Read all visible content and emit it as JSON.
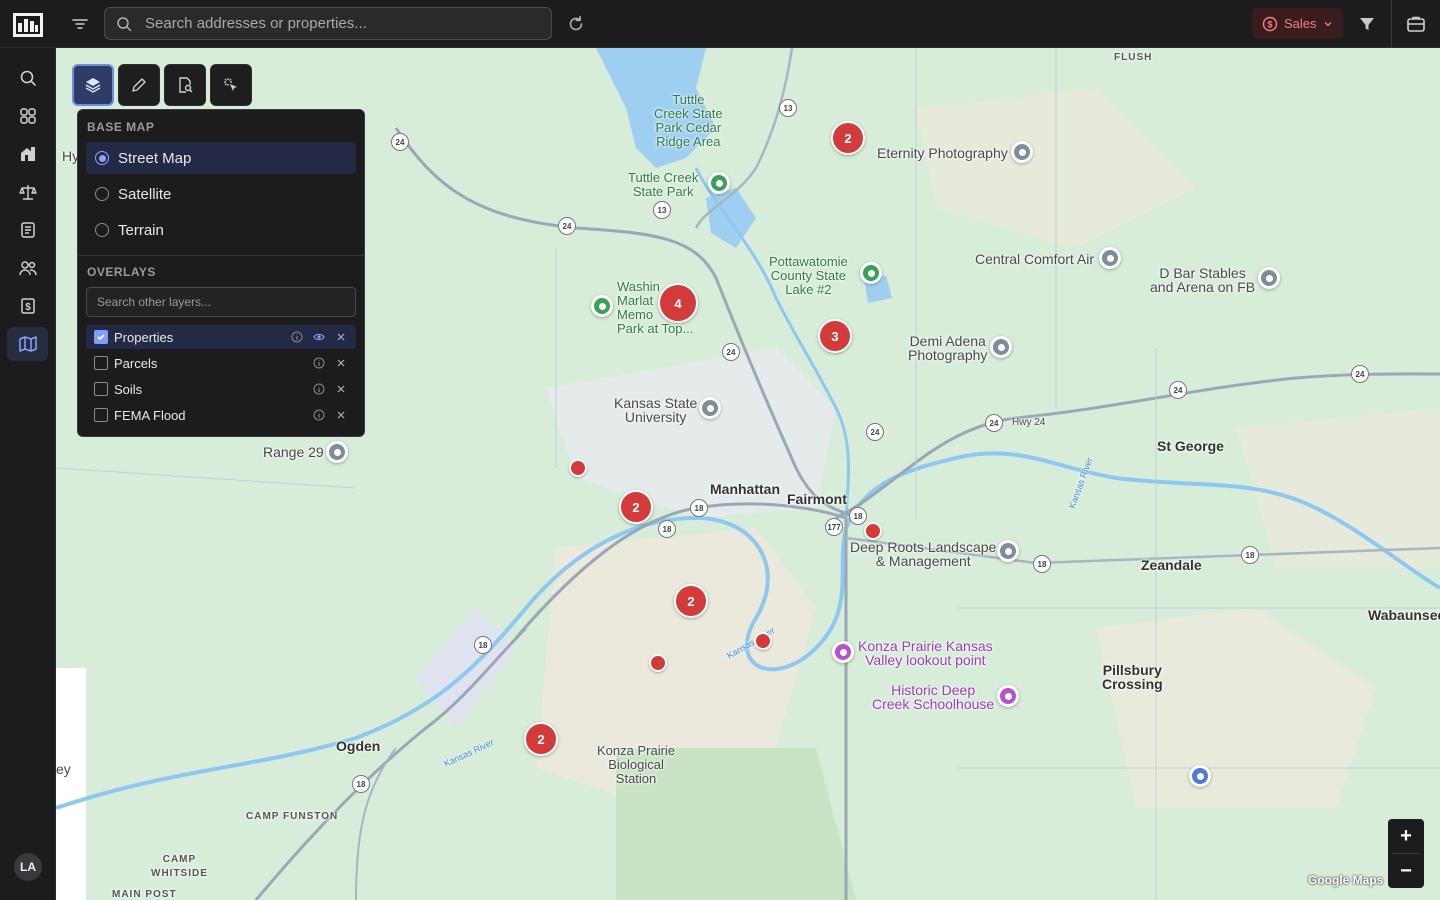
{
  "topbar": {
    "search_placeholder": "Search addresses or properties...",
    "sales_label": "Sales"
  },
  "sidebar": {
    "items": [
      "search",
      "dashboard",
      "properties",
      "legal",
      "documents",
      "contacts",
      "finance",
      "map"
    ],
    "active": "map",
    "avatar_initials": "LA"
  },
  "map_toolbar": {
    "tools": [
      "layers",
      "draw",
      "search-area",
      "select"
    ],
    "active": "layers"
  },
  "layers_panel": {
    "base_map_heading": "BASE MAP",
    "base_maps": [
      "Street Map",
      "Satellite",
      "Terrain"
    ],
    "selected_base_map": "Street Map",
    "overlays_heading": "OVERLAYS",
    "overlay_search_placeholder": "Search other layers...",
    "overlays": [
      {
        "name": "Properties",
        "checked": true
      },
      {
        "name": "Parcels",
        "checked": false
      },
      {
        "name": "Soils",
        "checked": false
      },
      {
        "name": "FEMA Flood",
        "checked": false
      }
    ]
  },
  "map": {
    "places": {
      "manhattan": "Manhattan",
      "fairmont": "Fairmont",
      "st_george": "St George",
      "zeandale": "Zeandale",
      "wabaunsee": "Wabaunsee",
      "ogden": "Ogden",
      "pillsbury": "Pillsbury\nCrossing",
      "flush": "FLUSH",
      "camp_funston": "CAMP FUNSTON",
      "camp_whitside": "CAMP\nWHITSIDE",
      "main_post": "MAIN POST",
      "range_29": "Range 29",
      "hwy24": "Hwy 24",
      "ey": "ey",
      "hy": "Hy"
    },
    "pois": {
      "tuttle_creek_park": "Tuttle\nCreek State\nPark Cedar\nRidge Area",
      "tuttle_creek_state_park": "Tuttle Creek\nState Park",
      "eternity": "Eternity Photography",
      "central_comfort": "Central Comfort Air",
      "d_bar": "D Bar Stables\nand Arena on FB",
      "pottawatomie": "Pottawatomie\nCounty State\nLake #2",
      "demi_adena": "Demi Adena\nPhotography",
      "washington_marlatt": "Washin\nMarlat\nMemo\nPark at Top...",
      "ksu": "Kansas State\nUniversity",
      "deep_roots": "Deep Roots Landscape\n& Management",
      "konza_lookout": "Konza Prairie Kansas\nValley lookout point",
      "historic_deep_creek": "Historic Deep\nCreek Schoolhouse",
      "konza_station": "Konza Prairie\nBiological\nStation"
    },
    "rivers": {
      "kansas_river_1": "Kansas River",
      "kansas_river_2": "Kansas River",
      "kansas_river_3": "Kansas River"
    },
    "route_shields": [
      "24",
      "13",
      "13",
      "24",
      "24",
      "24",
      "24",
      "24",
      "24",
      "18",
      "18",
      "177",
      "18",
      "18",
      "18",
      "18",
      "18"
    ],
    "clusters": [
      "2",
      "4",
      "3",
      "2",
      "2",
      "2"
    ],
    "attribution": "Google Maps"
  },
  "zoom": {
    "in": "+",
    "out": "−"
  },
  "colors": {
    "marker": "#d33b3b",
    "accent": "#8aa3ff",
    "sales": "#f08080"
  }
}
